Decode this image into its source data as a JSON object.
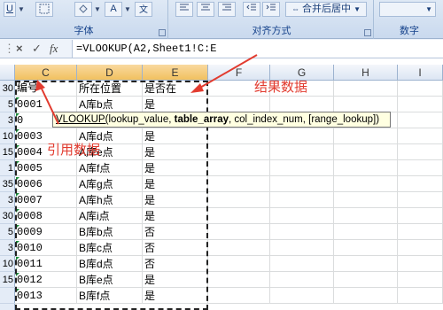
{
  "ribbon": {
    "groups": [
      {
        "name": "font",
        "label": "字体"
      },
      {
        "name": "alignment",
        "label": "对齐方式"
      },
      {
        "name": "number",
        "label": "数字"
      }
    ],
    "merge_center_label": "合并后居中",
    "font_color_glyph": "A",
    "underline_glyph": "U"
  },
  "formula_bar": {
    "cancel_icon": "×",
    "enter_icon": "✓",
    "fx_label": "fx",
    "formula": "=VLOOKUP(A2,Sheet1!C:E"
  },
  "columns": [
    "C",
    "D",
    "E",
    "F",
    "G",
    "H",
    "I"
  ],
  "row_numbers": [
    "30",
    "5",
    "3",
    "10",
    "15",
    "1",
    "35",
    "3",
    "30",
    "5",
    "3",
    "10",
    "15",
    ""
  ],
  "rows": [
    {
      "c": "编号",
      "d": "所在位置",
      "e": "是否在"
    },
    {
      "c": "0001",
      "d": "A库b点",
      "e": "是"
    },
    {
      "c": "0",
      "d": "",
      "e": ""
    },
    {
      "c": "0003",
      "d": "A库d点",
      "e": "是"
    },
    {
      "c": "0004",
      "d": "A库e点",
      "e": "是"
    },
    {
      "c": "0005",
      "d": "A库f点",
      "e": "是"
    },
    {
      "c": "0006",
      "d": "A库g点",
      "e": "是"
    },
    {
      "c": "0007",
      "d": "A库h点",
      "e": "是"
    },
    {
      "c": "0008",
      "d": "A库i点",
      "e": "是"
    },
    {
      "c": "0009",
      "d": "B库b点",
      "e": "否"
    },
    {
      "c": "0010",
      "d": "B库c点",
      "e": "否"
    },
    {
      "c": "0011",
      "d": "B库d点",
      "e": "否"
    },
    {
      "c": "0012",
      "d": "B库e点",
      "e": "是"
    },
    {
      "c": "0013",
      "d": "B库f点",
      "e": "是"
    }
  ],
  "tooltip": {
    "fn": "VLOOKUP(",
    "arg1": "lookup_value, ",
    "arg2_bold": "table_array",
    "rest": ", col_index_num, [range_lookup])"
  },
  "annotations": {
    "result": "结果数据",
    "reference": "引用数据"
  },
  "colors": {
    "annotation_red": "#e23b2f",
    "selected_header": "#f1c15f"
  }
}
